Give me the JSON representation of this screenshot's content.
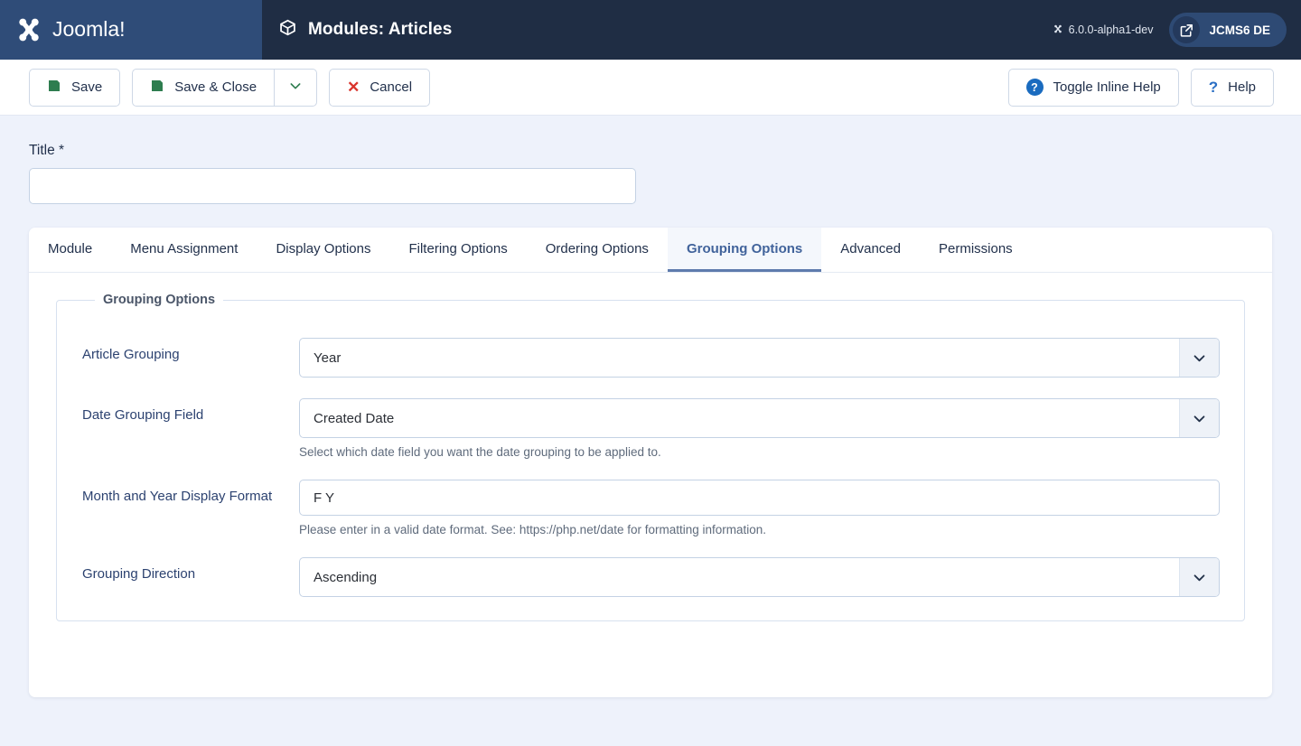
{
  "header": {
    "brand_name": "Joomla!",
    "brand_icon": "joomla-logo-icon",
    "page_icon": "cube-icon",
    "title": "Modules: Articles",
    "version_icon": "joomla-mark-icon",
    "version": "6.0.0-alpha1-dev",
    "site_link_icon": "external-link-icon",
    "site_name": "JCMS6 DE"
  },
  "toolbar": {
    "save_icon": "floppy-disk-icon",
    "save_label": "Save",
    "save_close_icon": "floppy-disk-icon",
    "save_close_label": "Save & Close",
    "save_dropdown_icon": "chevron-down-icon",
    "cancel_icon": "close-x-icon",
    "cancel_label": "Cancel",
    "toggle_help_icon": "question-circle-icon",
    "toggle_help_label": "Toggle Inline Help",
    "help_icon": "question-mark-icon",
    "help_label": "Help"
  },
  "form": {
    "title_label": "Title *",
    "title_value": "",
    "title_placeholder": ""
  },
  "tabs": [
    {
      "label": "Module",
      "active": false
    },
    {
      "label": "Menu Assignment",
      "active": false
    },
    {
      "label": "Display Options",
      "active": false
    },
    {
      "label": "Filtering Options",
      "active": false
    },
    {
      "label": "Ordering Options",
      "active": false
    },
    {
      "label": "Grouping Options",
      "active": true
    },
    {
      "label": "Advanced",
      "active": false
    },
    {
      "label": "Permissions",
      "active": false
    }
  ],
  "grouping": {
    "legend": "Grouping Options",
    "fields": [
      {
        "label": "Article Grouping",
        "type": "select",
        "value": "Year",
        "arrow_icon": "chevron-down-icon",
        "help": ""
      },
      {
        "label": "Date Grouping Field",
        "type": "select",
        "value": "Created Date",
        "arrow_icon": "chevron-down-icon",
        "help": "Select which date field you want the date grouping to be applied to."
      },
      {
        "label": "Month and Year Display Format",
        "type": "text",
        "value": "F Y",
        "help": "Please enter in a valid date format. See: https://php.net/date for formatting information."
      },
      {
        "label": "Grouping Direction",
        "type": "select",
        "value": "Ascending",
        "arrow_icon": "chevron-down-icon",
        "help": ""
      }
    ]
  },
  "colors": {
    "page_bg": "#eef2fb",
    "header_bg": "#1f2d44",
    "brand_bg": "#2f4c78",
    "accent_blue": "#41639b",
    "save_green": "#2e7d4f",
    "cancel_red": "#d9332b",
    "help_blue": "#1a6bbf"
  }
}
